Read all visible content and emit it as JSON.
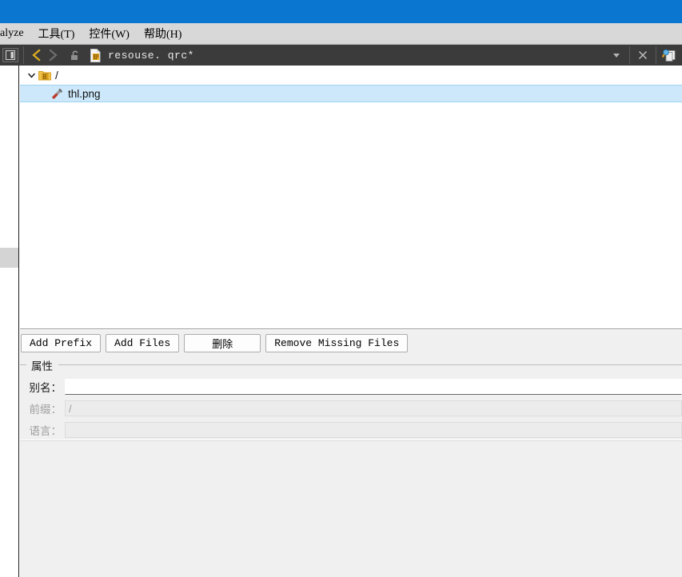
{
  "topbar": {
    "color": "#0a76cf"
  },
  "menubar": {
    "items": [
      {
        "name": "menu-analyze",
        "label": "alyze",
        "clipped": true
      },
      {
        "name": "menu-tools",
        "label": "工具(T)",
        "mnemonic": "T"
      },
      {
        "name": "menu-widgets",
        "label": "控件(W)",
        "mnemonic": "W"
      },
      {
        "name": "menu-help",
        "label": "帮助(H)",
        "mnemonic": "H"
      }
    ]
  },
  "toolbar": {
    "sidebar_toggle_icon": "sidebar-toggle-icon",
    "back_icon": "chevron-left-icon",
    "forward_icon": "chevron-right-icon",
    "lock_icon": "unlock-icon",
    "file_icon": "qrc-file-icon",
    "file_path": "resouse. qrc*",
    "dropdown_icon": "chevron-down-icon",
    "close_icon": "close-icon",
    "split_icon": "split-view-icon"
  },
  "tree": {
    "root": {
      "twisty_icon": "chevron-down-icon",
      "icon": "prefix-folder-icon",
      "label": "/"
    },
    "children": [
      {
        "icon": "png-file-icon",
        "label": "thl.png",
        "selected": true
      }
    ]
  },
  "buttons": [
    {
      "name": "add-prefix-button",
      "label": "Add Prefix"
    },
    {
      "name": "add-files-button",
      "label": "Add Files"
    },
    {
      "name": "remove-button",
      "label": "删除",
      "wide": true
    },
    {
      "name": "remove-missing-files-button",
      "label": "Remove Missing Files"
    }
  ],
  "properties": {
    "title": "属性",
    "rows": [
      {
        "name": "alias",
        "label": "别名：",
        "value": "",
        "disabled": false
      },
      {
        "name": "prefix",
        "label": "前缀：",
        "value": "/",
        "disabled": true
      },
      {
        "name": "language",
        "label": "语言：",
        "value": "",
        "disabled": true
      }
    ]
  }
}
